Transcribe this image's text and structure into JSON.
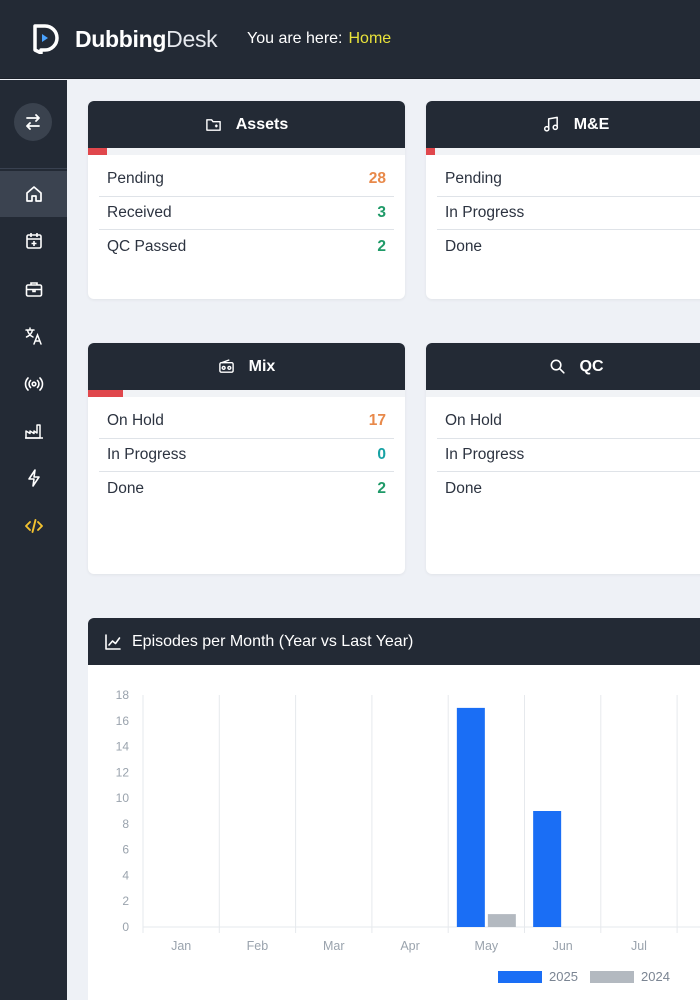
{
  "app": {
    "name_bold": "Dubbing",
    "name_light": "Desk"
  },
  "breadcrumb": {
    "prefix": "You are here:",
    "current": "Home"
  },
  "colors": {
    "chrome": "#232a35",
    "accent_yellow": "#e8e23a",
    "orange": "#e8894a",
    "green": "#1f9a68",
    "teal": "#17a2a4",
    "series_2025": "#1a6ef5",
    "series_2024": "#b3b9c0",
    "progress_red": "#e0474c"
  },
  "sidebar": {
    "items": [
      {
        "icon": "home-icon",
        "active": true
      },
      {
        "icon": "calendar-plus-icon",
        "active": false
      },
      {
        "icon": "briefcase-icon",
        "active": false
      },
      {
        "icon": "translate-icon",
        "active": false
      },
      {
        "icon": "broadcast-icon",
        "active": false
      },
      {
        "icon": "factory-icon",
        "active": false
      },
      {
        "icon": "lightning-icon",
        "active": false
      },
      {
        "icon": "code-icon",
        "active": false
      }
    ]
  },
  "cards": {
    "assets": {
      "title": "Assets",
      "icon": "folder-icon",
      "progress": 0.06,
      "rows": [
        {
          "label": "Pending",
          "value": "28",
          "tone": "orange"
        },
        {
          "label": "Received",
          "value": "3",
          "tone": "green"
        },
        {
          "label": "QC Passed",
          "value": "2",
          "tone": "green"
        }
      ]
    },
    "me": {
      "title": "M&E",
      "icon": "music-note-icon",
      "progress": 0.03,
      "rows": [
        {
          "label": "Pending",
          "value": "",
          "tone": "orange"
        },
        {
          "label": "In Progress",
          "value": "",
          "tone": "green"
        },
        {
          "label": "Done",
          "value": "",
          "tone": "green"
        }
      ]
    },
    "mix": {
      "title": "Mix",
      "icon": "radio-icon",
      "progress": 0.11,
      "rows": [
        {
          "label": "On Hold",
          "value": "17",
          "tone": "orange"
        },
        {
          "label": "In Progress",
          "value": "0",
          "tone": "teal"
        },
        {
          "label": "Done",
          "value": "2",
          "tone": "green"
        }
      ]
    },
    "qc": {
      "title": "QC",
      "icon": "search-icon",
      "progress": 0,
      "rows": [
        {
          "label": "On Hold",
          "value": "",
          "tone": "orange"
        },
        {
          "label": "In Progress",
          "value": "",
          "tone": "teal"
        },
        {
          "label": "Done",
          "value": "",
          "tone": "green"
        }
      ]
    }
  },
  "chart_panel": {
    "title": "Episodes per Month (Year vs Last Year)",
    "icon": "chart-line-icon"
  },
  "chart_data": {
    "type": "bar",
    "title": "Episodes per Month (Year vs Last Year)",
    "categories": [
      "Jan",
      "Feb",
      "Mar",
      "Apr",
      "May",
      "Jun",
      "Jul"
    ],
    "series": [
      {
        "name": "2025",
        "values": [
          0,
          0,
          0,
          0,
          17,
          9,
          0
        ],
        "color": "#1a6ef5"
      },
      {
        "name": "2024",
        "values": [
          0,
          0,
          0,
          0,
          1,
          0,
          0
        ],
        "color": "#b3b9c0"
      }
    ],
    "ylim": [
      0,
      18
    ],
    "yticks": [
      0,
      2,
      4,
      6,
      8,
      10,
      12,
      14,
      16,
      18
    ],
    "grid": "vertical",
    "legend": "bottom-right"
  }
}
